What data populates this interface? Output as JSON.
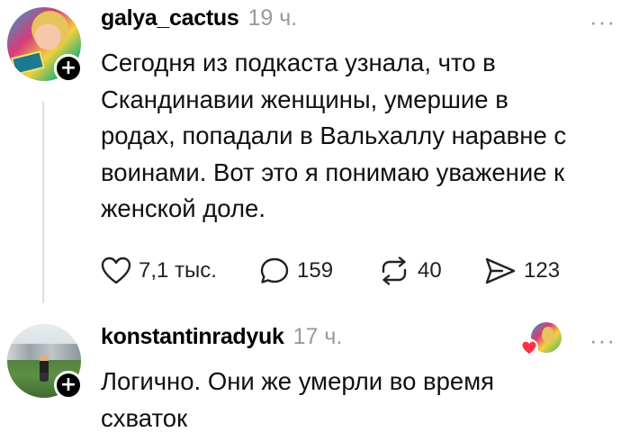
{
  "posts": [
    {
      "username": "galya_cactus",
      "time": "19 ч.",
      "more_label": "···",
      "text_lines": [
        "Сегодня из подкаста узнала, что в",
        "Скандинавии женщины, умершие в",
        "родах, попадали в Вальхаллу наравне с",
        "воинами. Вот это я понимаю уважение к",
        "женской доле."
      ],
      "actions": {
        "likes": "7,1 тыс.",
        "comments": "159",
        "reposts": "40",
        "shares": "123"
      },
      "avatar_icon": "profile-photo",
      "follow_icon": "plus-icon"
    },
    {
      "username": "konstantinradyuk",
      "time": "17 ч.",
      "more_label": "···",
      "text_lines": [
        "Логично. Они же умерли во время",
        "схваток"
      ],
      "avatar_icon": "profile-photo",
      "follow_icon": "plus-icon",
      "liked_by_author_icon": "heart-icon"
    }
  ],
  "colors": {
    "text": "#000000",
    "muted": "#9a9a9a",
    "heart": "#ff3040",
    "thread_line": "#e0e0e0"
  }
}
